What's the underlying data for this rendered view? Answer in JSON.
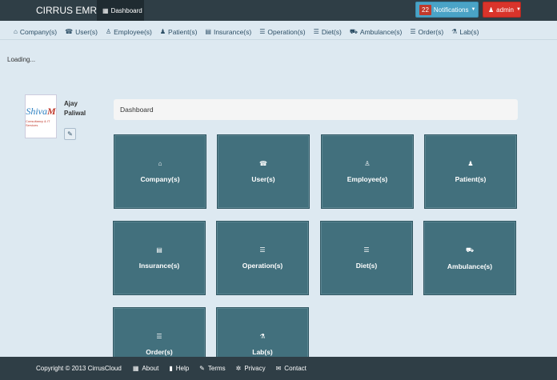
{
  "app": {
    "brand": "CIRRUS EMR",
    "nav_dashboard": "Dashboard",
    "notifications": {
      "count": "22",
      "label": "Notifications"
    },
    "admin_label": "admin"
  },
  "menu": [
    {
      "label": "Company(s)",
      "icon": "⌂"
    },
    {
      "label": "User(s)",
      "icon": "☎"
    },
    {
      "label": "Employee(s)",
      "icon": "♙"
    },
    {
      "label": "Patient(s)",
      "icon": "♟"
    },
    {
      "label": "Insurance(s)",
      "icon": "▤"
    },
    {
      "label": "Operation(s)",
      "icon": "☰"
    },
    {
      "label": "Diet(s)",
      "icon": "☰"
    },
    {
      "label": "Ambulance(s)",
      "icon": "⛟"
    },
    {
      "label": "Order(s)",
      "icon": "☰"
    },
    {
      "label": "Lab(s)",
      "icon": "⚗"
    }
  ],
  "loading": "Loading...",
  "profile": {
    "logo_main": "Shiva",
    "logo_accent": "M",
    "logo_sub": "Consultancy & IT Services",
    "name": "Ajay Paliwal"
  },
  "breadcrumb": "Dashboard",
  "tiles": [
    {
      "label": "Company(s)",
      "icon": "⌂"
    },
    {
      "label": "User(s)",
      "icon": "☎"
    },
    {
      "label": "Employee(s)",
      "icon": "♙"
    },
    {
      "label": "Patient(s)",
      "icon": "♟"
    },
    {
      "label": "Insurance(s)",
      "icon": "▤"
    },
    {
      "label": "Operation(s)",
      "icon": "☰"
    },
    {
      "label": "Diet(s)",
      "icon": "☰"
    },
    {
      "label": "Ambulance(s)",
      "icon": "⛟"
    },
    {
      "label": "Order(s)",
      "icon": "☰"
    },
    {
      "label": "Lab(s)",
      "icon": "⚗"
    }
  ],
  "footer": {
    "copyright": "Copyright © 2013 CirrusCloud",
    "links": [
      {
        "label": "About",
        "icon": "▦"
      },
      {
        "label": "Help",
        "icon": "▮"
      },
      {
        "label": "Terms",
        "icon": "✎"
      },
      {
        "label": "Privacy",
        "icon": "✲"
      },
      {
        "label": "Contact",
        "icon": "✉"
      }
    ]
  }
}
